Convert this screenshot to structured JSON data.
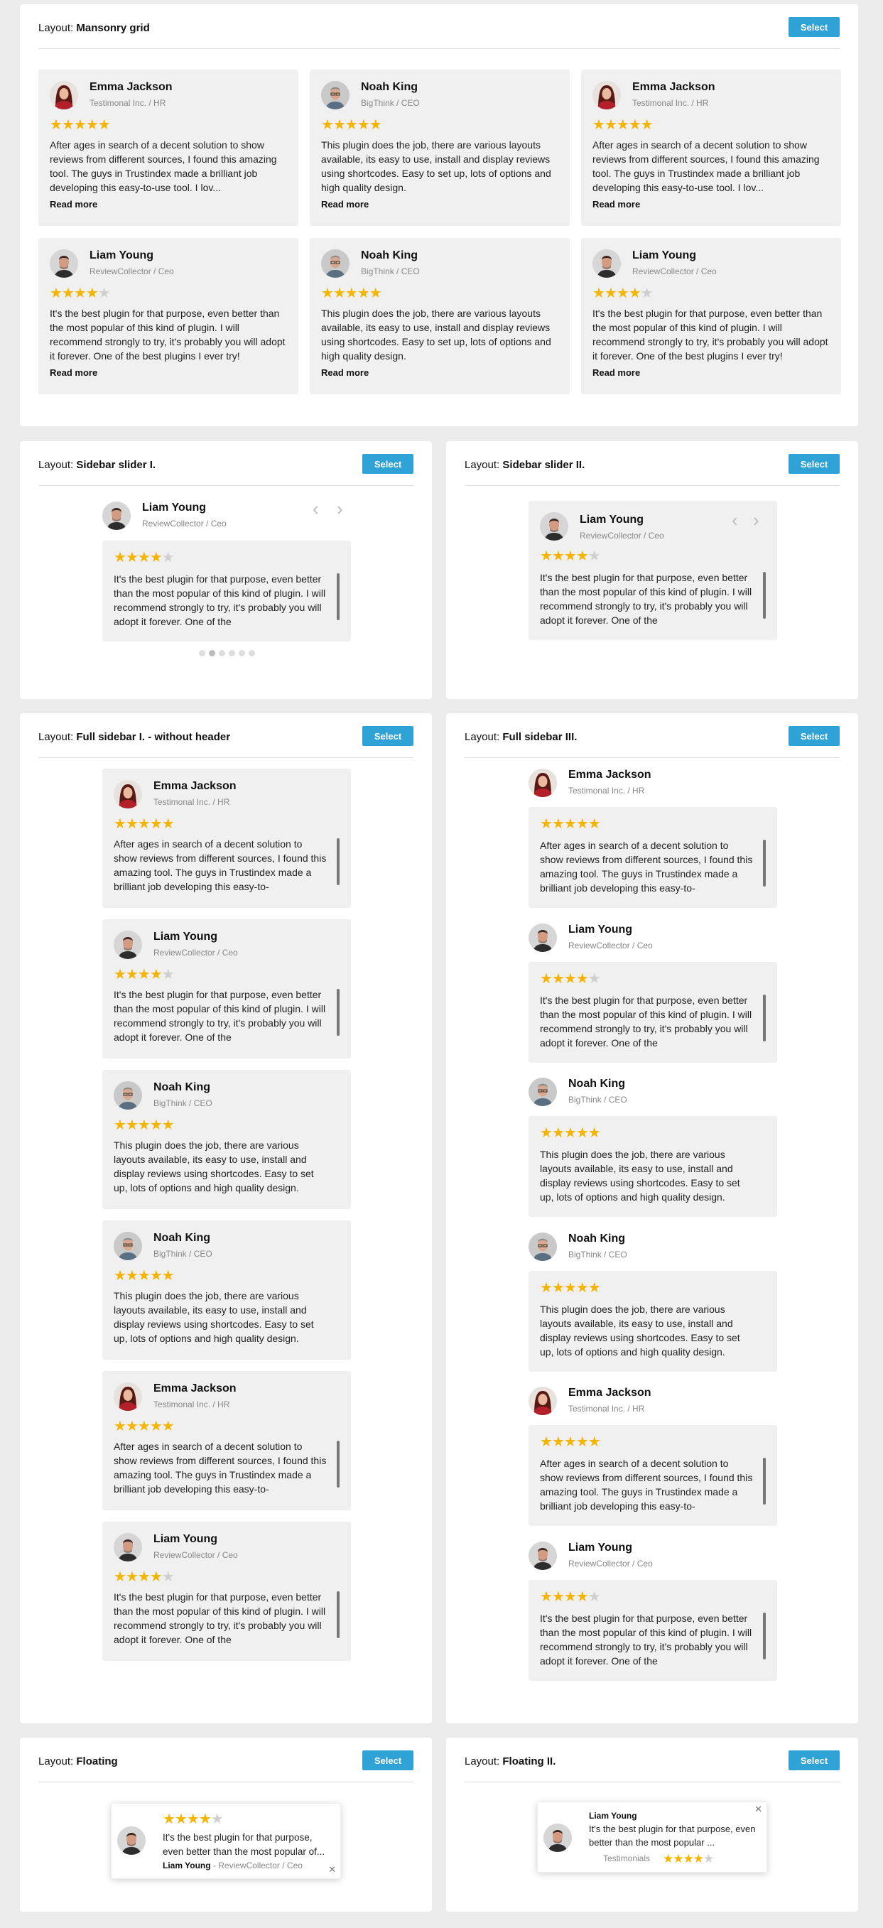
{
  "layout_prefix": "Layout:",
  "select_label": "Select",
  "read_more": "Read more",
  "panels": {
    "masonry": "Mansonry grid",
    "slider1": "Sidebar slider I.",
    "slider2": "Sidebar slider II.",
    "full1": "Full sidebar I. - without header",
    "full3": "Full sidebar III.",
    "floating": "Floating",
    "floating2": "Floating II."
  },
  "reviewers": {
    "emma": {
      "name": "Emma Jackson",
      "role": "Testimonal Inc. / HR",
      "rating": 5
    },
    "noah": {
      "name": "Noah King",
      "role": "BigThink / CEO",
      "rating": 5
    },
    "liam": {
      "name": "Liam Young",
      "role": "ReviewCollector / Ceo",
      "rating": 4
    }
  },
  "texts": {
    "emma": "After ages in search of a decent solution to show reviews from different sources, I found this amazing tool. The guys in Trustindex made a brilliant job developing this easy-to-use tool. I lov...",
    "emma_full": "After ages in search of a decent solution to show reviews from different sources, I found this amazing tool. The guys in Trustindex made a brilliant job developing this easy-to-",
    "noah": "This plugin does the job, there are various layouts available, its easy to use, install and display reviews using shortcodes. Easy to set up, lots of options and high quality design.",
    "liam": "It's the best plugin for that purpose, even better than the most popular of this kind of plugin. I will recommend strongly to try, it's probably you will adopt it forever. One of the best plugins I ever try!",
    "liam_short": "It's the best plugin for that purpose, even better than the most popular of this kind of plugin. I will recommend strongly to try, it's probably you will adopt it forever. One of the"
  },
  "floating": {
    "text": "It's the best plugin for that purpose, even better than the most popular of...",
    "author": "Liam Young",
    "separator": " - ",
    "role": "ReviewCollector / Ceo",
    "rating": 4
  },
  "floating2": {
    "name": "Liam Young",
    "text": "It's the best plugin for that purpose, even better than the most popular ...",
    "source": "Testimonials",
    "rating": 4
  },
  "colors": {
    "accent": "#2fa2d6",
    "star": "#f5b400",
    "card_bg": "#f0f0f0",
    "page_bg": "#ececec"
  },
  "icons": {
    "close": "close-icon",
    "prev": "chevron-left-icon",
    "next": "chevron-right-icon"
  }
}
